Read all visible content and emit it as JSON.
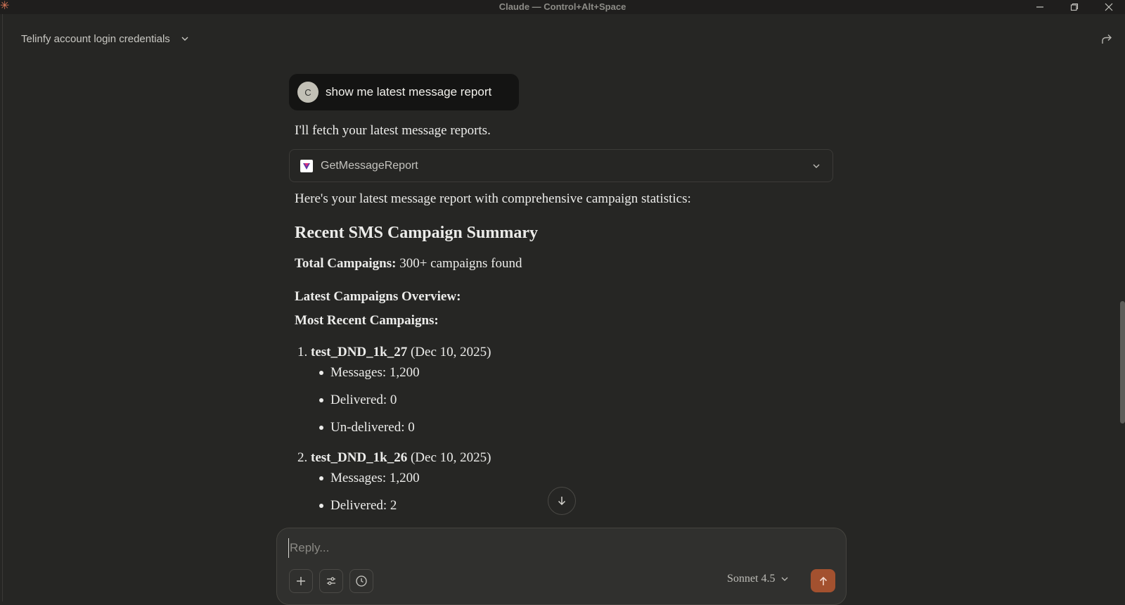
{
  "window": {
    "title": "Claude — Control+Alt+Space"
  },
  "conversation": {
    "title": "Telinfy account login credentials"
  },
  "user_message": {
    "avatar_initial": "C",
    "text": "show me latest message report"
  },
  "assistant": {
    "intro": "I'll fetch your latest message reports.",
    "tool_call": {
      "name": "GetMessageReport"
    },
    "lead": "Here's your latest message report with comprehensive campaign statistics:",
    "heading": "Recent SMS Campaign Summary",
    "total_label": "Total Campaigns:",
    "total_value": " 300+ campaigns found",
    "overview_heading": "Latest Campaigns Overview:",
    "recent_heading": "Most Recent Campaigns:",
    "campaigns": [
      {
        "number": "1.",
        "name": "test_DND_1k_27",
        "date": " (Dec 10, 2025)",
        "stats": [
          "Messages: 1,200",
          "Delivered: 0",
          "Un-delivered: 0"
        ]
      },
      {
        "number": "2.",
        "name": "test_DND_1k_26",
        "date": " (Dec 10, 2025)",
        "stats": [
          "Messages: 1,200",
          "Delivered: 2"
        ]
      }
    ]
  },
  "composer": {
    "placeholder": "Reply...",
    "model": "Sonnet 4.5"
  },
  "colors": {
    "background": "#262624",
    "accent": "#d97757",
    "send_button": "#a3512f"
  }
}
